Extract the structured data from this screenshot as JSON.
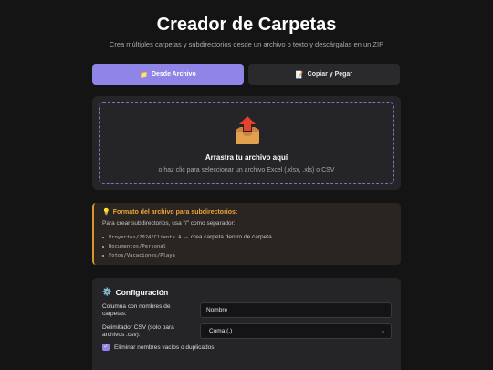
{
  "header": {
    "title": "Creador de Carpetas",
    "subtitle": "Crea múltiples carpetas y subdirectorios desde un archivo o texto y descárgalas en un ZIP"
  },
  "tabs": [
    {
      "label": "Desde Archivo",
      "icon": "folder-icon",
      "active": true
    },
    {
      "label": "Copiar y Pegar",
      "icon": "memo-icon",
      "active": false
    }
  ],
  "dropzone": {
    "icon": "inbox-upload-icon",
    "title": "Arrastra tu archivo aquí",
    "hint": "o haz clic para seleccionar un archivo Excel (.xlsx, .xls) o CSV"
  },
  "format_info": {
    "icon": "lightbulb-icon",
    "title": "Formato del archivo para subdirectorios:",
    "description": "Para crear subdirectorios, usa \"/\" como separador:",
    "examples": [
      {
        "path": "Proyectos/2024/Cliente A",
        "note": "→ crea carpeta dentro de carpeta"
      },
      {
        "path": "Documentos/Personal",
        "note": ""
      },
      {
        "path": "Fotos/Vacaciones/Playa",
        "note": ""
      }
    ]
  },
  "config": {
    "icon": "gear-icon",
    "title": "Configuración",
    "column_label": "Columna con nombres de carpetas:",
    "column_value": "Nombre",
    "delimiter_label": "Delimitador CSV (solo para archivos .csv):",
    "delimiter_value": "Coma (,)",
    "remove_label": "Eliminar nombres vacíos o duplicados",
    "remove_checked": true
  },
  "colors": {
    "accent": "#8e85e6",
    "warning": "#eaa53a",
    "background": "#141414",
    "card": "#252528"
  }
}
